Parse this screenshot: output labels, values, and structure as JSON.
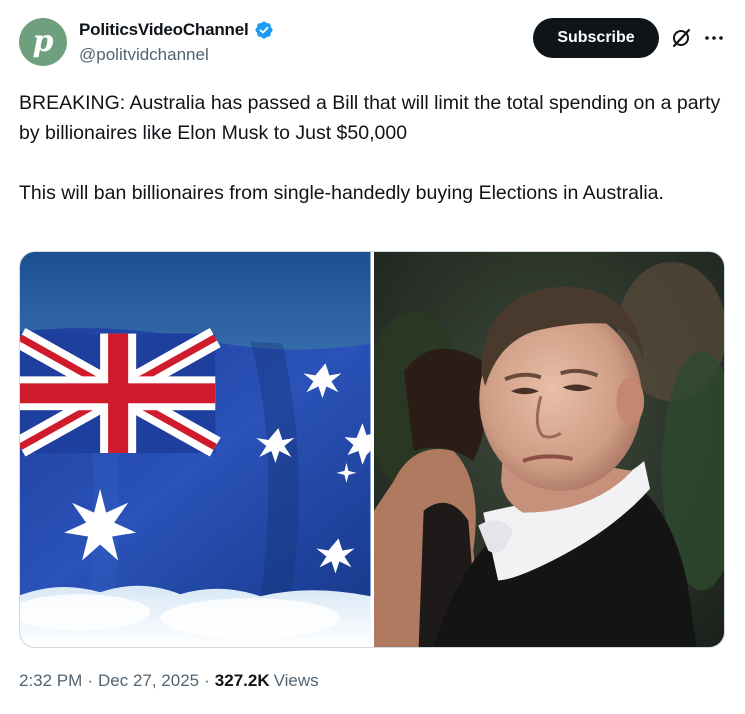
{
  "author": {
    "display_name": "PoliticsVideoChannel",
    "handle": "@politvidchannel",
    "avatar_letter": "p",
    "avatar_color": "#6fa07e",
    "verified_color": "#1d9bf0"
  },
  "actions": {
    "subscribe_label": "Subscribe",
    "grok_icon": "grok-icon",
    "more_icon": "more-horizontal-icon"
  },
  "tweet": {
    "paragraphs": [
      "BREAKING: Australia has passed a Bill that will limit the total spending on a party by billionaires like Elon Musk to Just $50,000",
      "This will ban billionaires from single-handedly buying Elections in Australia."
    ]
  },
  "media": [
    {
      "subject": "australian-flag"
    },
    {
      "subject": "man-in-tuxedo-portrait"
    }
  ],
  "meta": {
    "time": "2:32 PM",
    "separator": "·",
    "date": "Dec 27, 2025",
    "views_count": "327.2K",
    "views_label": "Views"
  },
  "colors": {
    "text_primary": "#0f1419",
    "text_secondary": "#536471",
    "button_bg": "#0f1419"
  }
}
